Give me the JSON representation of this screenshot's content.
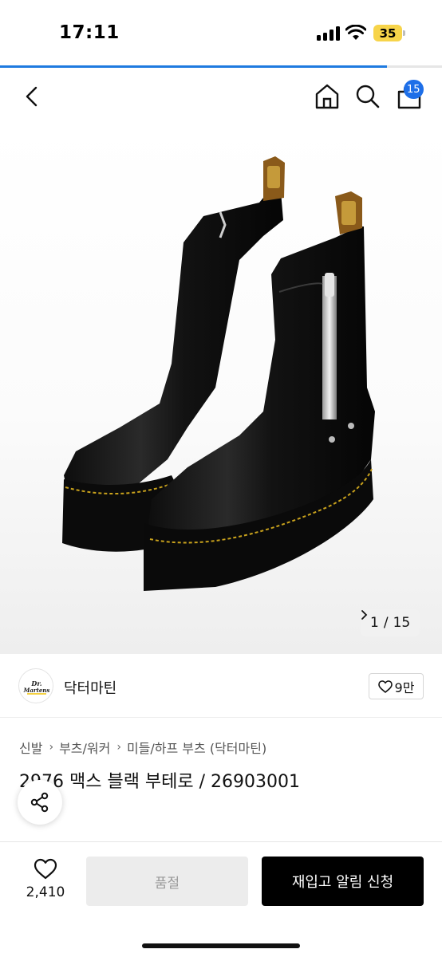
{
  "status_bar": {
    "time": "17:11",
    "battery": "35"
  },
  "page_load": {
    "progress": 0.875
  },
  "nav": {
    "cart_count": "15"
  },
  "gallery": {
    "current": "1",
    "total": "15",
    "separator": "/"
  },
  "brand": {
    "name": "닥터마틴",
    "logo_text": "Dr. Martens",
    "likes": "9만"
  },
  "breadcrumb": [
    "신발",
    "부츠/워커",
    "미들/하프 부츠 (닥터마틴)"
  ],
  "product": {
    "title": "2976 맥스 블랙 부테로 / 26903001"
  },
  "bottom_bar": {
    "wish_count": "2,410",
    "soldout_label": "품절",
    "restock_label": "재입고 알림 신청"
  },
  "colors": {
    "accent": "#1e6fe8",
    "battery": "#f7d44a",
    "primary_button": "#000000"
  }
}
